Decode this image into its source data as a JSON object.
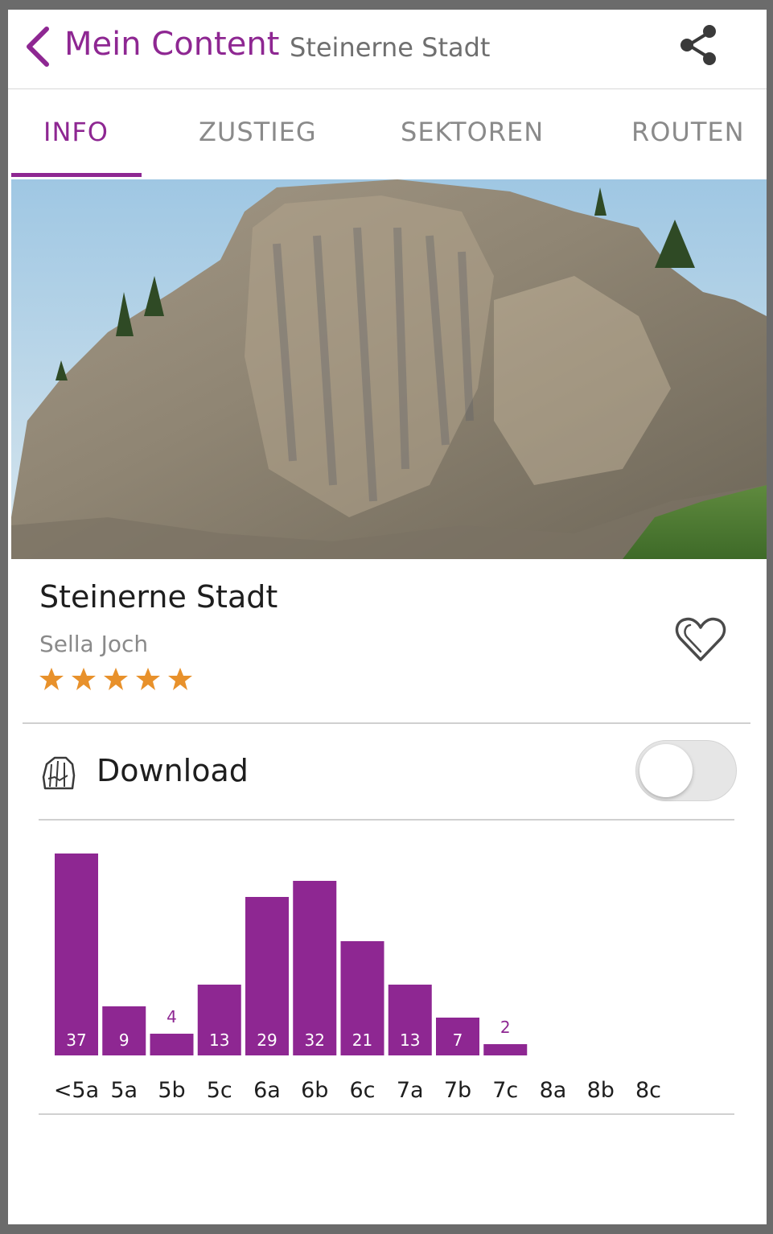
{
  "header": {
    "back_icon": "chevron-left-icon",
    "title": "Mein Content",
    "subtitle": "Steinerne Stadt",
    "share_icon": "share-icon"
  },
  "tabs": [
    {
      "label": "INFO",
      "active": true
    },
    {
      "label": "ZUSTIEG",
      "active": false
    },
    {
      "label": "SEKTOREN",
      "active": false
    },
    {
      "label": "ROUTEN",
      "active": false
    }
  ],
  "crag": {
    "name": "Steinerne Stadt",
    "area": "Sella Joch",
    "rating": 5,
    "favorite_icon": "heart-icon"
  },
  "download": {
    "icon": "rock-icon",
    "label": "Download",
    "enabled": false
  },
  "colors": {
    "accent": "#8e2792",
    "star": "#e8912b",
    "tab_inactive": "#8a8a8a"
  },
  "chart_data": {
    "type": "bar",
    "categories": [
      "<5a",
      "5a",
      "5b",
      "5c",
      "6a",
      "6b",
      "6c",
      "7a",
      "7b",
      "7c",
      "8a",
      "8b",
      "8c"
    ],
    "values": [
      37,
      9,
      4,
      13,
      29,
      32,
      21,
      13,
      7,
      2,
      0,
      0,
      0
    ],
    "labels": [
      "37",
      "9",
      "4",
      "13",
      "29",
      "32",
      "21",
      "13",
      "7",
      "2",
      "",
      "",
      ""
    ],
    "color": "#8e2792"
  }
}
